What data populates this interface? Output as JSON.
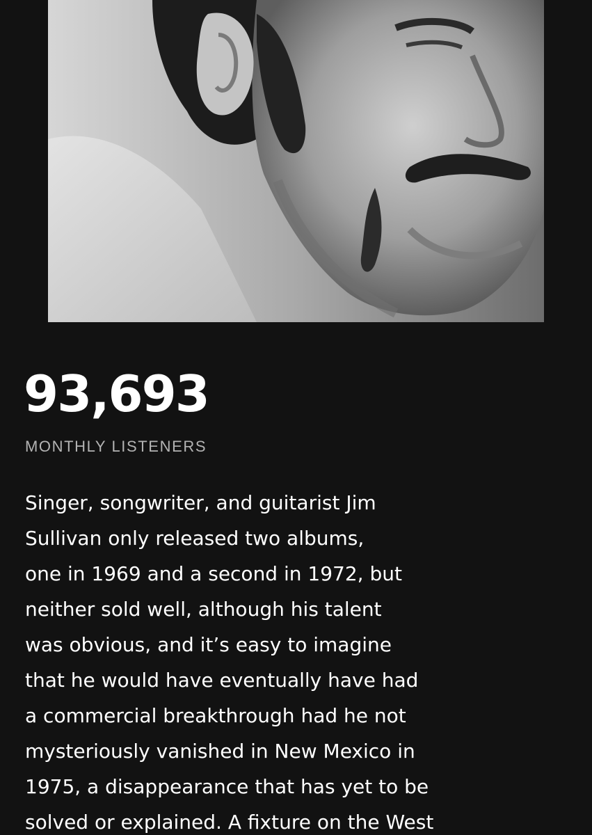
{
  "artist": {
    "photo_icon": "artist-portrait-image",
    "monthly_listeners_count": "93,693",
    "monthly_listeners_label": "MONTHLY LISTENERS"
  },
  "bio": {
    "lines": [
      "Singer, songwriter, and guitarist Jim",
      "Sullivan only released two albums,",
      "one in 1969 and a second in 1972, but",
      "neither sold well, although his talent",
      "was obvious, and it’s easy to imagine",
      "that he would have eventually have had",
      "a commercial breakthrough had he not",
      "mysteriously vanished in New Mexico in",
      "1975, a disappearance that has yet to be",
      "solved or explained. A fixture on the West"
    ]
  },
  "colors": {
    "background": "#121212",
    "primary_text": "#ffffff",
    "secondary_text": "#b3b3b3"
  }
}
